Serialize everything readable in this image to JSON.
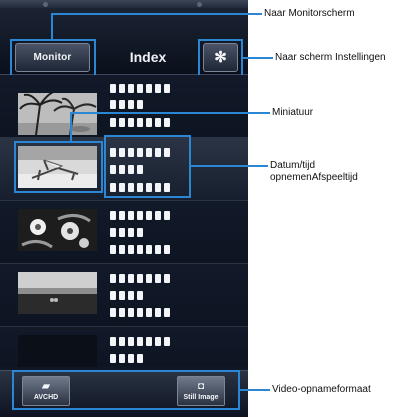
{
  "screen": {
    "monitor_button": "Monitor",
    "title": "Index",
    "settings_icon": "gear-icon",
    "rows": [
      {
        "thumb": "palm-trees-beach"
      },
      {
        "thumb": "beach-chair"
      },
      {
        "thumb": "flowers-plant"
      },
      {
        "thumb": "sunset-sea"
      },
      {
        "thumb": "dark-placeholder"
      }
    ],
    "format_buttons": [
      {
        "label": "AVCHD",
        "icon": "video-camera-icon"
      },
      {
        "label": "Still Image",
        "icon": "camera-icon"
      }
    ]
  },
  "callouts": {
    "monitor": "Naar Monitorscherm",
    "settings": "Naar scherm Instellingen",
    "thumbnail": "Miniatuur",
    "datetime_line1": "Datum/tijd",
    "datetime_line2": "opnemenAfspeeltijd",
    "format": "Video-opnameformaat"
  },
  "colors": {
    "callout_blue": "#2b86d4",
    "screen_bg": "#0f1624"
  }
}
